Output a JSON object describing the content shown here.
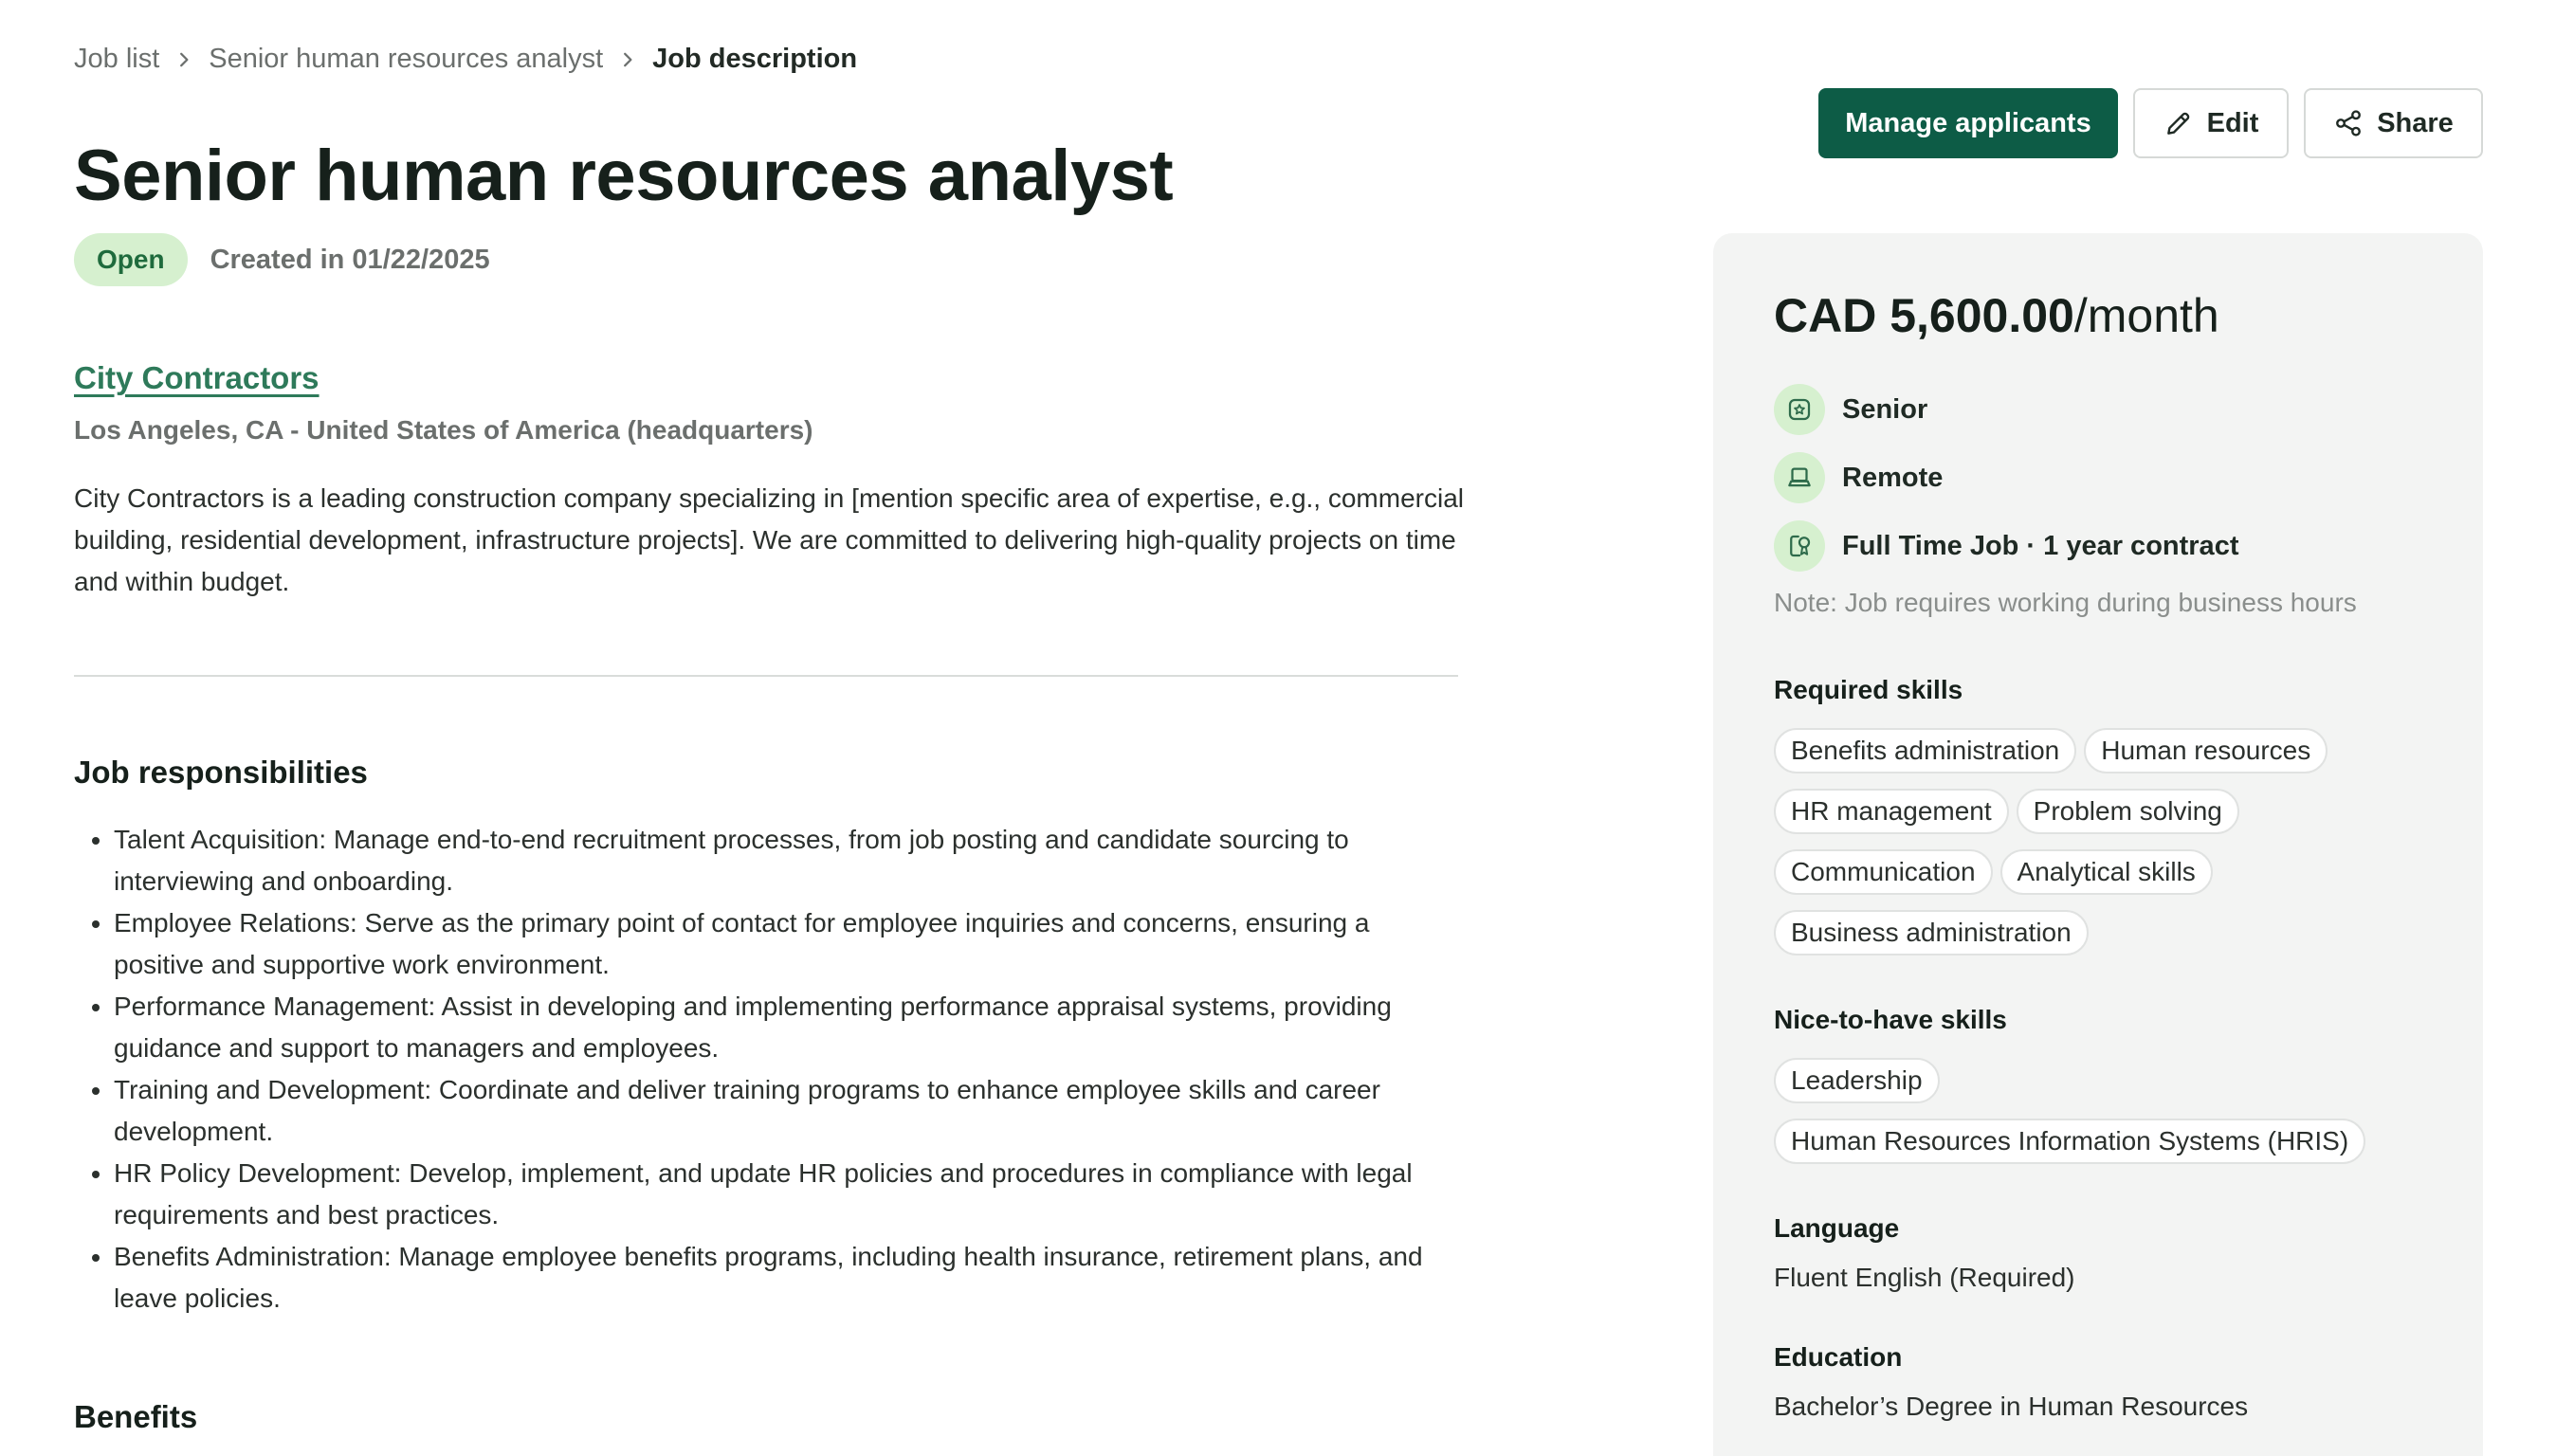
{
  "breadcrumb": {
    "items": [
      "Job list",
      "Senior human resources analyst",
      "Job description"
    ]
  },
  "actions": {
    "manage_label": "Manage applicants",
    "edit_label": "Edit",
    "share_label": "Share"
  },
  "job": {
    "title": "Senior human resources analyst",
    "status": "Open",
    "created": "Created in 01/22/2025"
  },
  "company": {
    "name": "City Contractors",
    "location": "Los Angeles, CA - United States of America (headquarters)",
    "description": "City Contractors is a leading construction company specializing in [mention specific area of expertise, e.g., commercial building, residential development, infrastructure projects]. We are committed to delivering high-quality projects on time and within budget."
  },
  "responsibilities": {
    "title": "Job responsibilities",
    "items": [
      "Talent Acquisition: Manage end-to-end recruitment processes, from job posting and candidate sourcing to interviewing and onboarding.",
      "Employee Relations: Serve as the primary point of contact for employee inquiries and concerns, ensuring a positive and supportive work environment.",
      "Performance Management: Assist in developing and implementing performance appraisal systems, providing guidance and support to managers and employees.",
      "Training and Development: Coordinate and deliver training programs to enhance employee skills and career development.",
      "HR Policy Development: Develop, implement, and update HR policies and procedures in compliance with legal requirements and best practices.",
      "Benefits Administration: Manage employee benefits programs, including health insurance, retirement plans, and leave policies."
    ]
  },
  "benefits": {
    "title": "Benefits"
  },
  "sidebar": {
    "salary_amount": "CAD 5,600.00",
    "salary_period": "/month",
    "attributes": [
      {
        "icon": "seniority-badge-icon",
        "label": "Senior"
      },
      {
        "icon": "laptop-icon",
        "label": "Remote"
      },
      {
        "icon": "contract-icon",
        "label": "Full Time Job · 1 year contract"
      }
    ],
    "note": "Note: Job requires working during business hours",
    "required_skills_title": "Required skills",
    "required_skills": [
      "Benefits administration",
      "Human resources",
      "HR management",
      "Problem solving",
      "Communication",
      "Analytical skills",
      "Business administration"
    ],
    "nice_skills_title": "Nice-to-have skills",
    "nice_skills": [
      "Leadership",
      "Human Resources Information Systems (HRIS)"
    ],
    "language_title": "Language",
    "language": "Fluent English (Required)",
    "education_title": "Education",
    "education": "Bachelor’s Degree in Human Resources"
  },
  "colors": {
    "primary": "#0d5c46",
    "link": "#2e7a5a",
    "badge_bg": "#d6f0cf",
    "card_bg": "#f3f4f3"
  }
}
